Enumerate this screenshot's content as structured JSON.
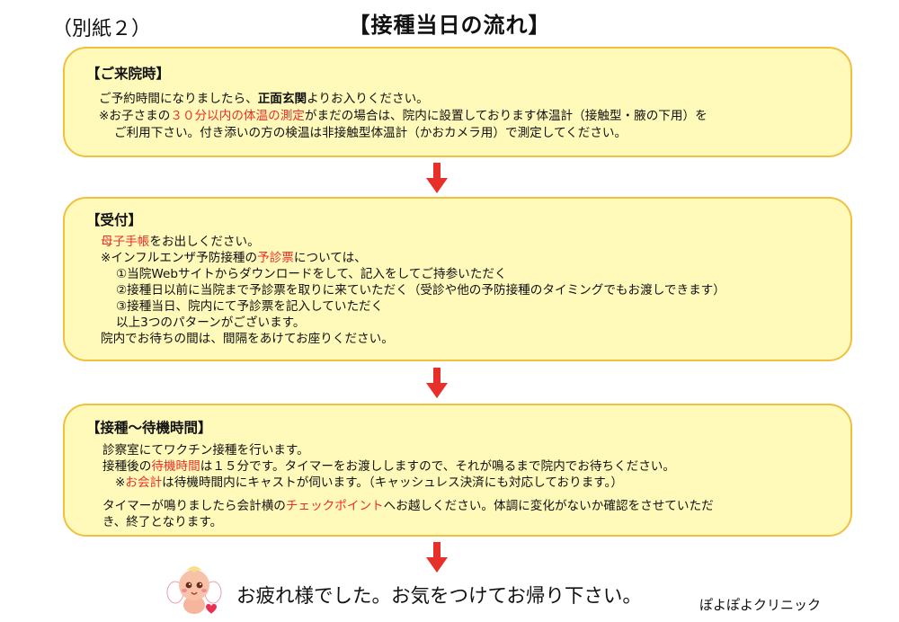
{
  "header": {
    "annex": "（別紙２）",
    "title": "【接種当日の流れ】"
  },
  "section1": {
    "heading": "【ご来院時】",
    "line1": {
      "pre": "ご予約時間になりましたら、",
      "bold": "正面玄関",
      "post": "よりお入りください。"
    },
    "line2": {
      "pre": "※お子さまの",
      "red": "３０分以内の体温の測定",
      "post": "がまだの場合は、院内に設置しております体温計（接触型・腋の下用）を"
    },
    "line3": "ご利用下さい。付き添いの方の検温は非接触型体温計（かおカメラ用）で測定してください。"
  },
  "section2": {
    "heading": "【受付】",
    "line1": {
      "red": "母子手帳",
      "post": "をお出しください。"
    },
    "line2": {
      "pre": "※インフルエンザ予防接種の",
      "red": "予診票",
      "post": "については、"
    },
    "line3": "①当院Webサイトからダウンロードをして、記入をしてご持参いただく",
    "line4": "②接種日以前に当院まで予診票を取りに来ていただく（受診や他の予防接種のタイミングでもお渡しできます）",
    "line5": "③接種当日、院内にて予診票を記入していただく",
    "line6": "以上3つのパターンがございます。",
    "line7": "院内でお待ちの間は、間隔をあけてお座りください。"
  },
  "section3": {
    "heading": "【接種～待機時間】",
    "line1": "診察室にてワクチン接種を行います。",
    "line2": {
      "pre": "接種後の",
      "red": "待機時間",
      "post": "は１５分です。タイマーをお渡ししますので、それが鳴るまで院内でお待ちください。"
    },
    "line3": {
      "pre": "※",
      "red": "お会計",
      "post": "は待機時間内にキャストが伺います。（キャッシュレス決済にも対応しております。）"
    },
    "line4": {
      "pre": "タイマーが鳴りましたら会計横の",
      "red": "チェックポイント",
      "post": "へお越しください。体調に変化がないか確認をさせていただ"
    },
    "line5": "き、終了となります。"
  },
  "footer": {
    "message": "お疲れ様でした。お気をつけてお帰り下さい。",
    "clinic": "ぽよぽよクリニック"
  },
  "colors": {
    "box_fill": "#fff9ba",
    "box_border": "#f0c040",
    "accent_red": "#e8302a",
    "arrow": "#e8302a"
  },
  "icons": {
    "arrow": "down-arrow-icon",
    "mascot": "cherub-mascot-icon"
  }
}
